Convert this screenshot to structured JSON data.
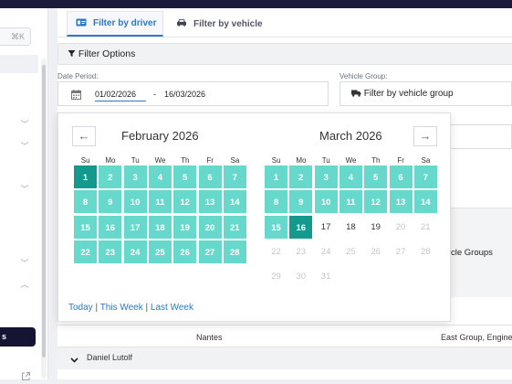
{
  "sidebar": {
    "shortcut": "⌘K",
    "active_label": "s"
  },
  "tabs": {
    "driver": "Filter by driver",
    "vehicle": "Filter by vehicle"
  },
  "filter_options": {
    "title": "Filter Options",
    "date_label": "Date Period:",
    "date_from": "01/02/2026",
    "date_sep": "-",
    "date_to": "16/03/2026",
    "vehicle_group_label": "Vehicle Group:",
    "vehicle_group_value": "Filter by vehicle group"
  },
  "groups_text": "cle Groups",
  "table": {
    "row1_city": "Nantes",
    "row1_groups": "East Group, Engine",
    "row2_driver": "Daniel Lutolf"
  },
  "picker": {
    "weekdays": [
      "Su",
      "Mo",
      "Tu",
      "We",
      "Th",
      "Fr",
      "Sa"
    ],
    "left_month": "February 2026",
    "right_month": "March 2026",
    "prev_arrow": "←",
    "next_arrow": "→",
    "feb_days": [
      "1",
      "2",
      "3",
      "4",
      "5",
      "6",
      "7",
      "8",
      "9",
      "10",
      "11",
      "12",
      "13",
      "14",
      "15",
      "16",
      "17",
      "18",
      "19",
      "20",
      "21",
      "22",
      "23",
      "24",
      "25",
      "26",
      "27",
      "28"
    ],
    "mar_days": [
      "1",
      "2",
      "3",
      "4",
      "5",
      "6",
      "7",
      "8",
      "9",
      "10",
      "11",
      "12",
      "13",
      "14",
      "15",
      "16",
      "17",
      "18",
      "19",
      "20",
      "21",
      "22",
      "23",
      "24",
      "25",
      "26",
      "27",
      "28",
      "29",
      "30",
      "31"
    ],
    "quick_today": "Today",
    "quick_week": "This Week",
    "quick_last": "Last Week",
    "quick_sep": "|"
  }
}
